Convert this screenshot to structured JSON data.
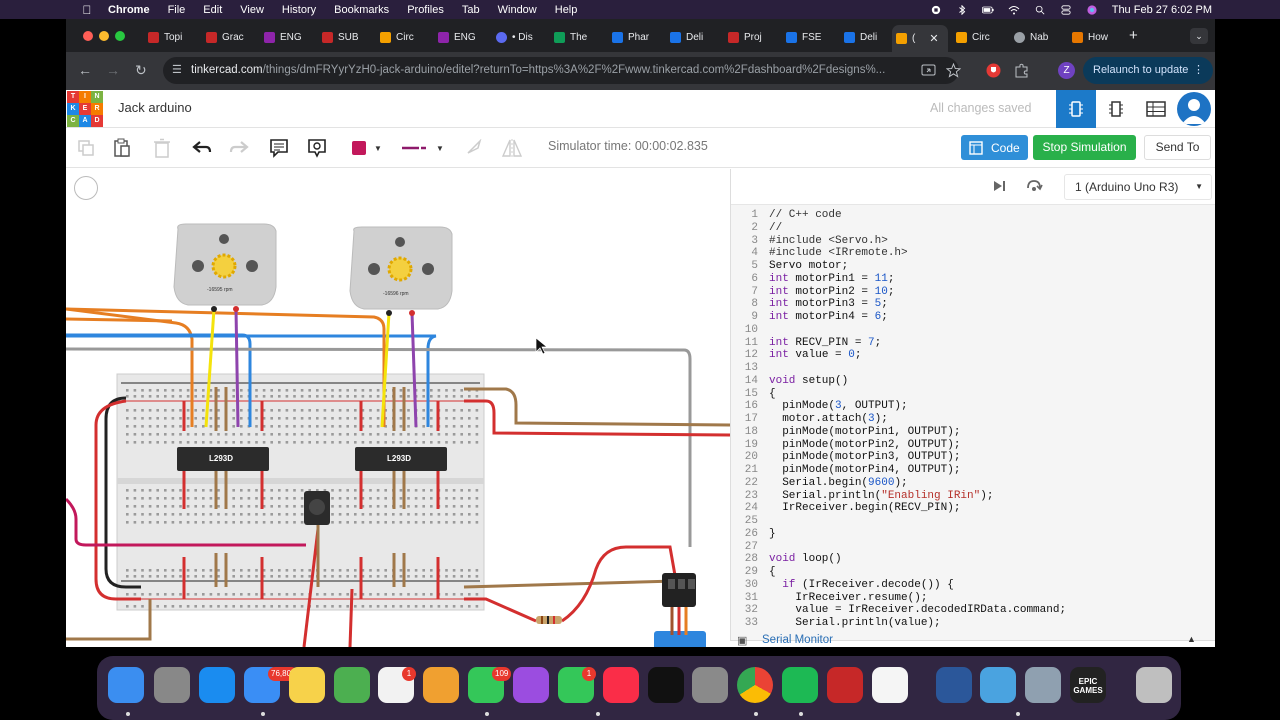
{
  "menubar": {
    "app_name": "Chrome",
    "menus": [
      "File",
      "Edit",
      "View",
      "History",
      "Bookmarks",
      "Profiles",
      "Tab",
      "Window",
      "Help"
    ],
    "clock": "Thu Feb 27  6:02 PM"
  },
  "browser": {
    "tabs": [
      {
        "label": "Topi",
        "color": "#c62828"
      },
      {
        "label": "Grac",
        "color": "#c62828"
      },
      {
        "label": "ENG",
        "color": "#8e24aa"
      },
      {
        "label": "SUB",
        "color": "#c62828"
      },
      {
        "label": "Circ",
        "color": "#f4a000"
      },
      {
        "label": "ENG",
        "color": "#8e24aa"
      },
      {
        "label": "• Dis",
        "color": "#5b6af0"
      },
      {
        "label": "The",
        "color": "#0f9d58"
      },
      {
        "label": "Phar",
        "color": "#1a73e8"
      },
      {
        "label": "Deli",
        "color": "#1a73e8"
      },
      {
        "label": "Proj",
        "color": "#c62828"
      },
      {
        "label": "FSE",
        "color": "#1a73e8"
      },
      {
        "label": "Deli",
        "color": "#1a73e8"
      },
      {
        "label": "(",
        "color": "#f4a000"
      },
      {
        "label": "Circ",
        "color": "#f4a000"
      },
      {
        "label": "Nab",
        "color": "#9aa0a6"
      },
      {
        "label": "How",
        "color": "#e67700"
      }
    ],
    "url_host": "tinkercad.com",
    "url_path": "/things/dmFRYyrYzH0-jack-arduino/editel?returnTo=https%3A%2F%2Fwww.tinkercad.com%2Fdashboard%2Fdesigns%...",
    "profile_initial": "Z",
    "relaunch_label": "Relaunch to update"
  },
  "tinkercad": {
    "logo_letters": [
      "TIN",
      "KER",
      "CAD"
    ],
    "project_title": "Jack arduino",
    "save_status": "All changes saved",
    "simulator_time": "Simulator time: 00:00:02.835",
    "code_button": "Code",
    "stop_button": "Stop Simulation",
    "send_button": "Send To",
    "board_select": "1 (Arduino Uno R3)",
    "serial_monitor": "Serial Monitor",
    "circuit": {
      "motor1_rpm": "-16595 rpm",
      "motor2_rpm": "-16596 rpm",
      "chip1_label": "L293D",
      "chip2_label": "L293D"
    }
  },
  "code_lines": [
    "// C++ code",
    "//",
    "#include <Servo.h>",
    "#include <IRremote.h>",
    "Servo motor;",
    "int motorPin1 = 11;",
    "int motorPin2 = 10;",
    "int motorPin3 = 5;",
    "int motorPin4 = 6;",
    "",
    "int RECV_PIN = 7;",
    "int value = 0;",
    "",
    "void setup()",
    "{",
    "  pinMode(3, OUTPUT);",
    "  motor.attach(3);",
    "  pinMode(motorPin1, OUTPUT);",
    "  pinMode(motorPin2, OUTPUT);",
    "  pinMode(motorPin3, OUTPUT);",
    "  pinMode(motorPin4, OUTPUT);",
    "  Serial.begin(9600);",
    "  Serial.println(\"Enabling IRin\");",
    "  IrReceiver.begin(RECV_PIN);",
    "",
    "}",
    "",
    "void loop()",
    "{",
    "  if (IrReceiver.decode()) {",
    "    IrReceiver.resume();",
    "    value = IrReceiver.decodedIRData.command;",
    "    Serial.println(value);"
  ],
  "dock": {
    "items": [
      {
        "name": "finder",
        "color": "#3b8ef0"
      },
      {
        "name": "launchpad",
        "color": "#888"
      },
      {
        "name": "safari",
        "color": "#1a8cf0"
      },
      {
        "name": "mail",
        "color": "#3a8ef5",
        "badge": "76,807"
      },
      {
        "name": "notes",
        "color": "#f7d24a"
      },
      {
        "name": "maps",
        "color": "#4caf50"
      },
      {
        "name": "reminders",
        "color": "#f2f2f2",
        "badge": "1"
      },
      {
        "name": "photos",
        "color": "#f0a030"
      },
      {
        "name": "messages",
        "color": "#34c759",
        "badge": "109"
      },
      {
        "name": "podcasts",
        "color": "#9b4de0"
      },
      {
        "name": "facetime",
        "color": "#34c759",
        "badge": "1"
      },
      {
        "name": "music",
        "color": "#fa2d48"
      },
      {
        "name": "tv",
        "color": "#111"
      },
      {
        "name": "system-settings",
        "color": "#8a8a8a"
      },
      {
        "name": "chrome",
        "color": "#e8e8e8"
      },
      {
        "name": "spotify",
        "color": "#1db954"
      },
      {
        "name": "photo-booth",
        "color": "#c62828"
      },
      {
        "name": "slack",
        "color": "#f5f5f5"
      },
      {
        "name": "word",
        "color": "#2b579a"
      },
      {
        "name": "network",
        "color": "#4aa3e0"
      },
      {
        "name": "preview",
        "color": "#8fa0b0"
      },
      {
        "name": "epic-games",
        "color": "#222"
      },
      {
        "name": "trash",
        "color": "#bfbfbf"
      }
    ],
    "epic_label": "EPIC GAMES"
  }
}
